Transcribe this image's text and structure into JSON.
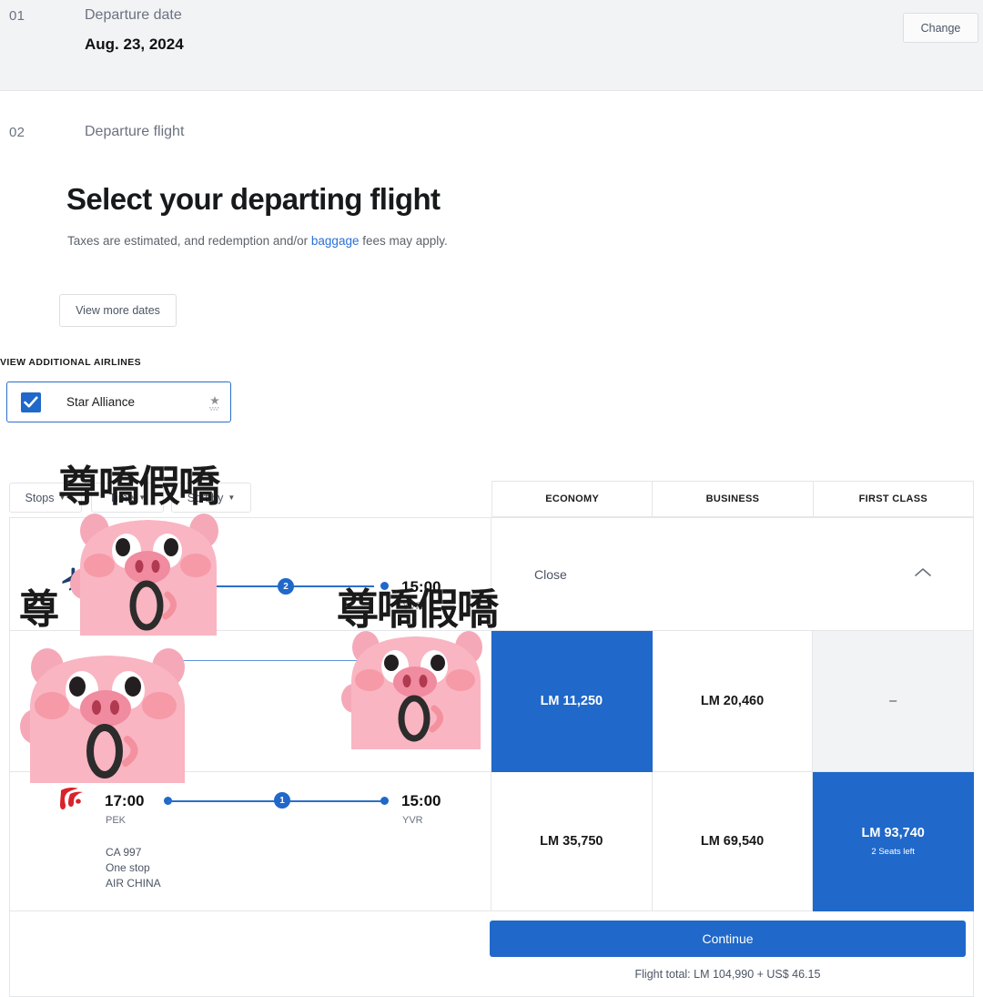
{
  "step_one": {
    "number": "01",
    "label": "Departure date",
    "value": "Aug. 23, 2024",
    "change_label": "Change"
  },
  "step_two": {
    "number": "02",
    "label": "Departure flight",
    "headline": "Select your departing flight",
    "subline_before": "Taxes are estimated, and redemption and/or ",
    "subline_link": "baggage",
    "subline_after": " fees may apply.",
    "view_more_dates_label": "View more dates"
  },
  "additional_airlines": {
    "title": "VIEW ADDITIONAL AIRLINES",
    "option_label": "Star Alliance",
    "checked": true,
    "logo_icon": "star-alliance-logo"
  },
  "filters": [
    {
      "label": "Stops",
      "icon": "chevron-down-icon"
    },
    {
      "label": "Time",
      "icon": "chevron-down-icon"
    },
    {
      "label": "Sort by",
      "icon": "chevron-down-icon"
    }
  ],
  "columns": [
    "ECONOMY",
    "BUSINESS",
    "FIRST CLASS"
  ],
  "rows": [
    {
      "id": "row-1",
      "expanded": true,
      "depart_time": "",
      "depart_code": "",
      "arrive_time": "15:00",
      "arrive_code": "YVR",
      "stops_badge": "2",
      "details_label": "Details",
      "collapse_label": "Close",
      "collapse_icon": "chevron-up-icon"
    },
    {
      "id": "row-2",
      "depart_time": "",
      "depart_code": "",
      "arrive_time": "",
      "arrive_code": "",
      "prices": [
        {
          "class": "ECONOMY",
          "value": "LM 11,250",
          "state": "selected"
        },
        {
          "class": "BUSINESS",
          "value": "LM 20,460",
          "state": "available"
        },
        {
          "class": "FIRST CLASS",
          "value": "–",
          "state": "unavailable"
        }
      ]
    },
    {
      "id": "row-3",
      "airline_logo": "air-china-logo",
      "depart_time": "17:00",
      "depart_code": "PEK",
      "arrive_time": "15:00",
      "arrive_code": "YVR",
      "stops_badge": "1",
      "flight_number": "CA 997",
      "stops_text": "One stop",
      "airline_name": "AIR CHINA",
      "prices": [
        {
          "class": "ECONOMY",
          "value": "LM 35,750",
          "state": "available",
          "seats": ""
        },
        {
          "class": "BUSINESS",
          "value": "LM 69,540",
          "state": "available",
          "seats": ""
        },
        {
          "class": "FIRST CLASS",
          "value": "LM 93,740",
          "state": "selected",
          "seats": "2 Seats left"
        }
      ]
    }
  ],
  "footer": {
    "continue_label": "Continue",
    "flight_total": "Flight total: LM 104,990 + US$ 46.15"
  },
  "overlays": {
    "meme_text": "尊嘺假嘺",
    "meme_text_partial": "尊",
    "sticker_name": "pig-sticker"
  },
  "colors": {
    "accent_blue": "#2068c9",
    "link_blue": "#2a6fd6",
    "air_china_red": "#d8232a",
    "panel_gray": "#f2f3f5",
    "border_gray": "#e4e6e9"
  }
}
